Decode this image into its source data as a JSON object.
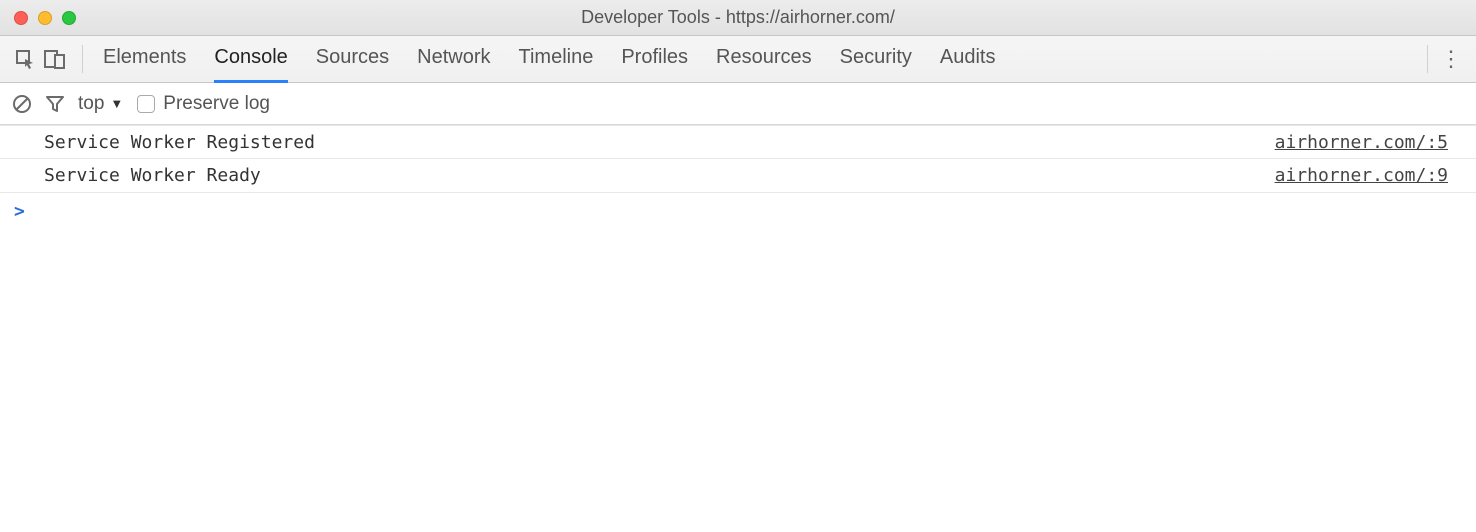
{
  "window": {
    "title": "Developer Tools - https://airhorner.com/"
  },
  "tabs": [
    "Elements",
    "Console",
    "Sources",
    "Network",
    "Timeline",
    "Profiles",
    "Resources",
    "Security",
    "Audits"
  ],
  "activeTab": "Console",
  "filter": {
    "context": "top",
    "preserve_label": "Preserve log",
    "preserve_checked": false
  },
  "log": [
    {
      "message": "Service Worker Registered",
      "source": "airhorner.com/:5"
    },
    {
      "message": "Service Worker Ready",
      "source": "airhorner.com/:9"
    }
  ],
  "prompt": ">"
}
